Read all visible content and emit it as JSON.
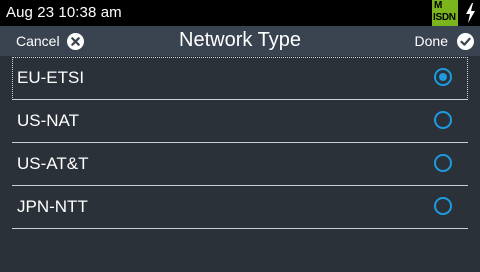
{
  "status": {
    "datetime": "Aug 23 10:38 am",
    "badge_top": "M",
    "badge_bottom": "ISDN"
  },
  "header": {
    "cancel_label": "Cancel",
    "title": "Network Type",
    "done_label": "Done"
  },
  "options": [
    {
      "label": "EU-ETSI",
      "selected": true
    },
    {
      "label": "US-NAT",
      "selected": false
    },
    {
      "label": "US-AT&T",
      "selected": false
    },
    {
      "label": "JPN-NTT",
      "selected": false
    }
  ],
  "colors": {
    "accent": "#1e9be0",
    "badge": "#7ab51d"
  }
}
